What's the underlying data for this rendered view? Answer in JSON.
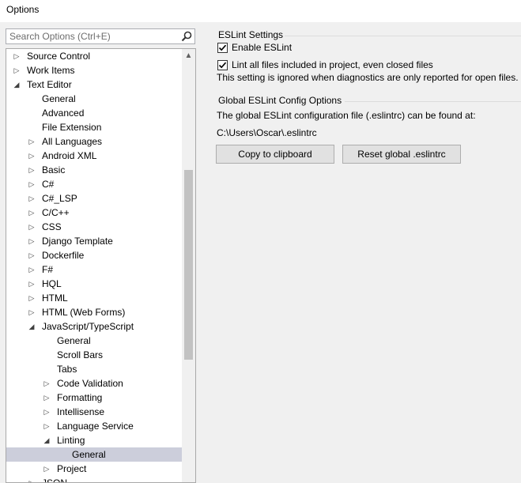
{
  "window": {
    "title": "Options"
  },
  "search": {
    "placeholder": "Search Options (Ctrl+E)"
  },
  "tree": [
    {
      "label": "Source Control",
      "level": 0,
      "exp": "collapsed"
    },
    {
      "label": "Work Items",
      "level": 0,
      "exp": "collapsed"
    },
    {
      "label": "Text Editor",
      "level": 0,
      "exp": "expanded"
    },
    {
      "label": "General",
      "level": 1,
      "exp": "none"
    },
    {
      "label": "Advanced",
      "level": 1,
      "exp": "none"
    },
    {
      "label": "File Extension",
      "level": 1,
      "exp": "none"
    },
    {
      "label": "All Languages",
      "level": 1,
      "exp": "collapsed"
    },
    {
      "label": "Android XML",
      "level": 1,
      "exp": "collapsed"
    },
    {
      "label": "Basic",
      "level": 1,
      "exp": "collapsed"
    },
    {
      "label": "C#",
      "level": 1,
      "exp": "collapsed"
    },
    {
      "label": "C#_LSP",
      "level": 1,
      "exp": "collapsed"
    },
    {
      "label": "C/C++",
      "level": 1,
      "exp": "collapsed"
    },
    {
      "label": "CSS",
      "level": 1,
      "exp": "collapsed"
    },
    {
      "label": "Django Template",
      "level": 1,
      "exp": "collapsed"
    },
    {
      "label": "Dockerfile",
      "level": 1,
      "exp": "collapsed"
    },
    {
      "label": "F#",
      "level": 1,
      "exp": "collapsed"
    },
    {
      "label": "HQL",
      "level": 1,
      "exp": "collapsed"
    },
    {
      "label": "HTML",
      "level": 1,
      "exp": "collapsed"
    },
    {
      "label": "HTML (Web Forms)",
      "level": 1,
      "exp": "collapsed"
    },
    {
      "label": "JavaScript/TypeScript",
      "level": 1,
      "exp": "expanded"
    },
    {
      "label": "General",
      "level": 2,
      "exp": "none"
    },
    {
      "label": "Scroll Bars",
      "level": 2,
      "exp": "none"
    },
    {
      "label": "Tabs",
      "level": 2,
      "exp": "none"
    },
    {
      "label": "Code Validation",
      "level": 2,
      "exp": "collapsed"
    },
    {
      "label": "Formatting",
      "level": 2,
      "exp": "collapsed"
    },
    {
      "label": "Intellisense",
      "level": 2,
      "exp": "collapsed"
    },
    {
      "label": "Language Service",
      "level": 2,
      "exp": "collapsed"
    },
    {
      "label": "Linting",
      "level": 2,
      "exp": "expanded"
    },
    {
      "label": "General",
      "level": 3,
      "exp": "none",
      "selected": true
    },
    {
      "label": "Project",
      "level": 2,
      "exp": "collapsed"
    },
    {
      "label": "JSON",
      "level": 1,
      "exp": "collapsed"
    }
  ],
  "eslint": {
    "heading": "ESLint Settings",
    "enable_label": "Enable ESLint",
    "enable_checked": true,
    "lint_all_label": "Lint all files included in project, even closed files",
    "lint_all_checked": true,
    "note": "This setting is ignored when diagnostics are only reported for open files."
  },
  "global": {
    "heading": "Global ESLint Config Options",
    "description": "The global ESLint configuration file (.eslintrc) can be found at:",
    "path": "C:\\Users\\Oscar\\.eslintrc",
    "copy_button": "Copy to clipboard",
    "reset_button": "Reset global .eslintrc"
  },
  "colors": {
    "selected_row": "#cccedb",
    "button_bg": "#e1e1e1",
    "button_border": "#adadad"
  }
}
